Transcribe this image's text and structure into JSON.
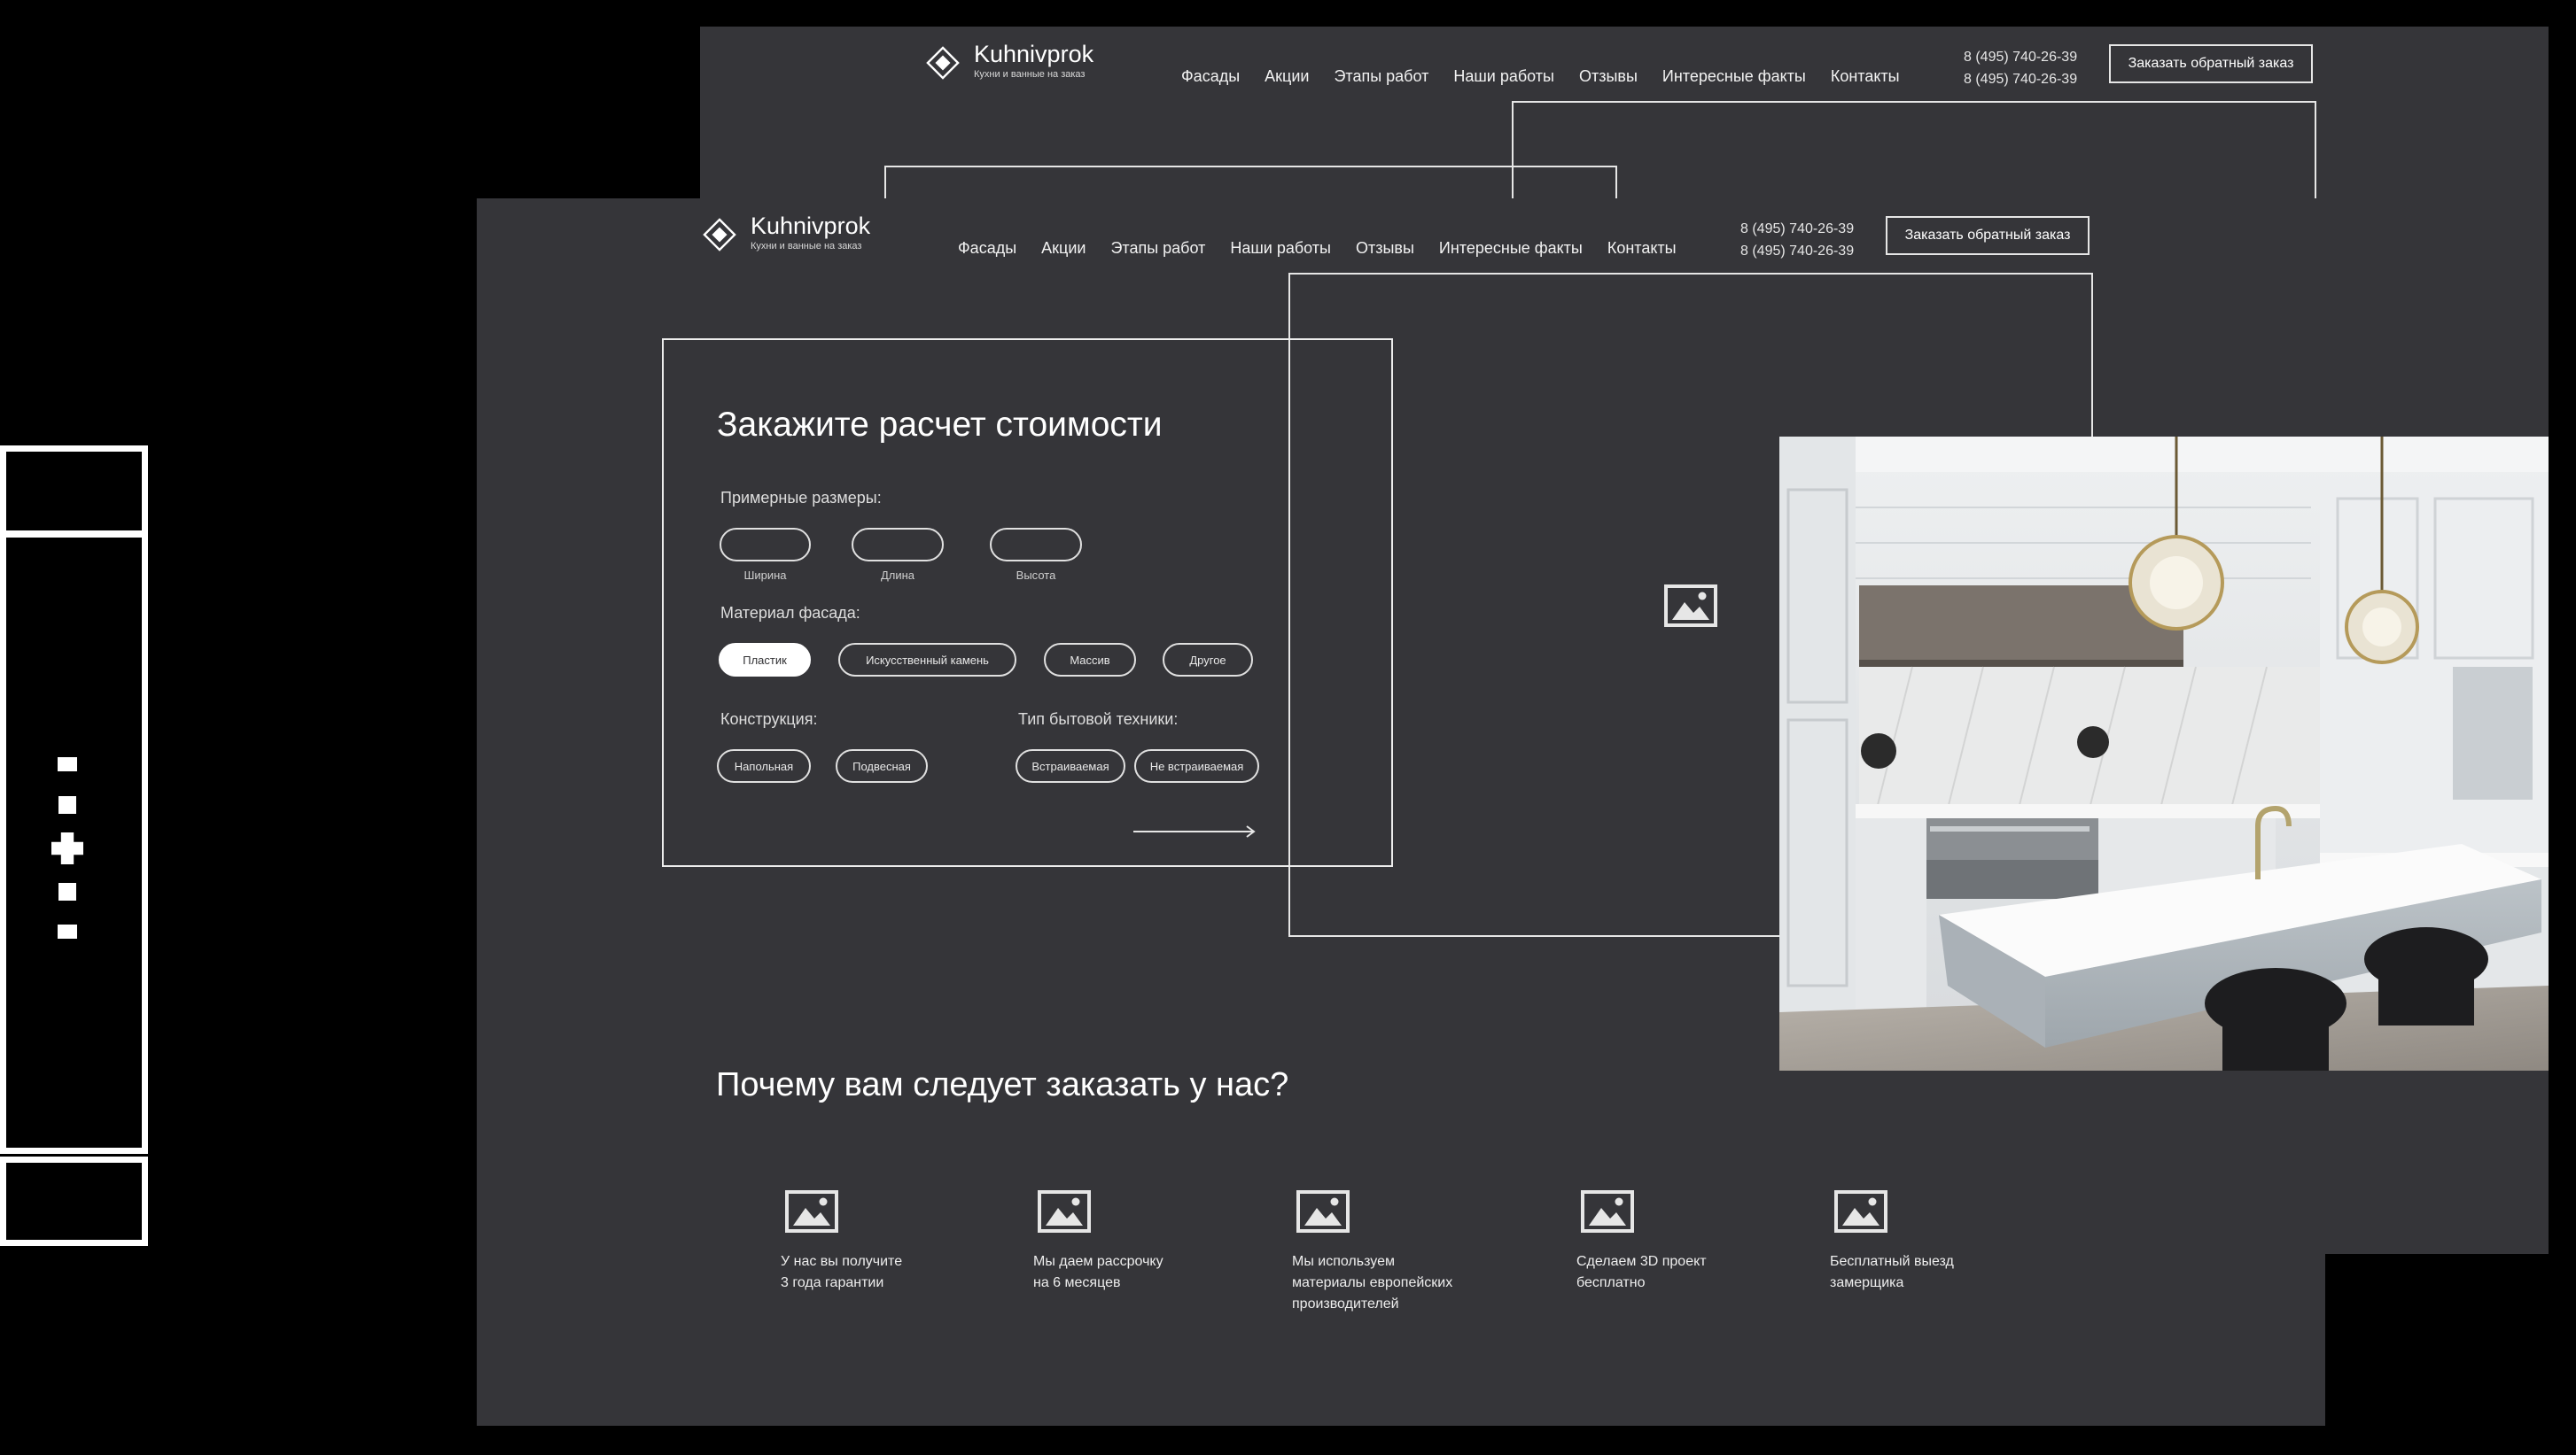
{
  "brand": {
    "name": "Kuhnivprok",
    "tagline": "Кухни и ванные на заказ"
  },
  "nav": [
    "Фасады",
    "Акции",
    "Этапы работ",
    "Наши работы",
    "Отзывы",
    "Интересные факты",
    "Контакты"
  ],
  "phones": [
    "8 (495) 740-26-39",
    "8 (495) 740-26-39"
  ],
  "callback_label": "Заказать обратный заказ",
  "form": {
    "title": "Закажите расчет стоимости",
    "sizes_label": "Примерные размеры:",
    "size_fields": [
      "Ширина",
      "Длина",
      "Высота"
    ],
    "material_label": "Материал фасада:",
    "materials": [
      "Пластик",
      "Искусственный камень",
      "Массив",
      "Другое"
    ],
    "selected_material": "Пластик",
    "construction_label": "Конструкция:",
    "constructions": [
      "Напольная",
      "Подвесная"
    ],
    "appliance_label": "Тип бытовой техники:",
    "appliances": [
      "Встраиваемая",
      "Не встраиваемая"
    ]
  },
  "why": {
    "title": "Почему вам следует заказать у нас?",
    "features": [
      {
        "lines": [
          "У нас вы получите",
          "3 года гарантии"
        ]
      },
      {
        "lines": [
          "Мы даем рассрочку",
          "на 6 месяцев"
        ]
      },
      {
        "lines": [
          "Мы используем",
          "материалы европейских",
          "производителей"
        ]
      },
      {
        "lines": [
          "Сделаем 3D проект",
          "бесплатно"
        ]
      },
      {
        "lines": [
          "Бесплатный выезд",
          "замерщика"
        ]
      }
    ]
  },
  "icons": {
    "logo": "diamond-logo-icon",
    "image_placeholder": "image-placeholder-icon",
    "arrow": "arrow-right-icon"
  },
  "colors": {
    "page_bg": "#000000",
    "sheet_bg": "#353539",
    "line": "#e6e6e6",
    "text": "#ffffff"
  }
}
